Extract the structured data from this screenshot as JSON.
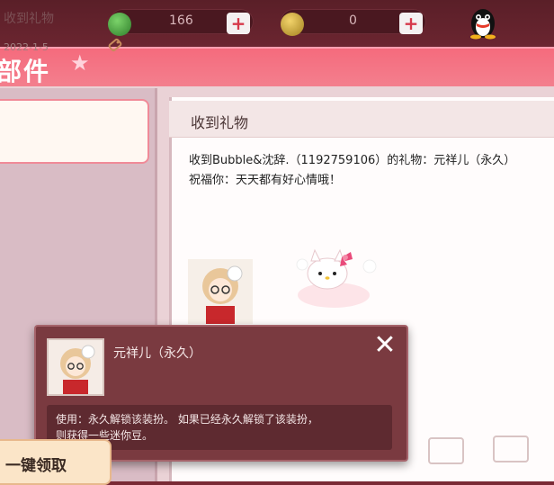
{
  "currency": {
    "green_amount": "166",
    "gold_amount": "0",
    "plus_symbol": "+"
  },
  "header": {
    "title": "部件"
  },
  "mail_list": {
    "items": [
      {
        "title": "收到礼物",
        "date": "2022-1-5"
      }
    ]
  },
  "content": {
    "title": "收到礼物",
    "line1": "收到Bubble&沈辞.（1192759106）的礼物：元祥儿（永久）",
    "line2": "祝福你：天天都有好心情哦！"
  },
  "popup": {
    "item_name": "元祥儿（永久）",
    "close_symbol": "✕",
    "desc_line1": "使用：永久解锁该装扮。 如果已经永久解锁了该装扮，",
    "desc_line2": "则获得一些迷你豆。"
  },
  "claim_all_label": "一键领取",
  "colors": {
    "accent": "#f3818f",
    "panel": "#ead2d6",
    "popup": "#7a3a40"
  },
  "icons": [
    "green-gem-icon",
    "gold-coin-icon",
    "qq-penguin-icon",
    "attachment-tag-icon",
    "close-icon"
  ]
}
